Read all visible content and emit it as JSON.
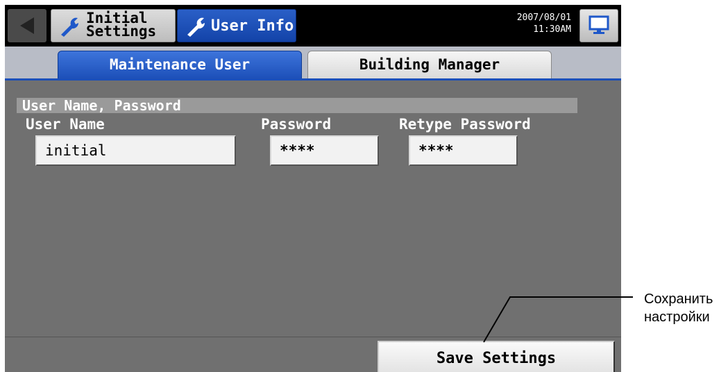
{
  "header": {
    "initial_settings_label": "Initial\nSettings",
    "user_info_label": "User Info",
    "date": "2007/08/01",
    "time": "11:30AM"
  },
  "tabs": [
    {
      "label": "Maintenance User",
      "active": true
    },
    {
      "label": "Building Manager",
      "active": false
    }
  ],
  "section": {
    "title": "User Name, Password",
    "fields": [
      {
        "label": "User Name",
        "value": "initial"
      },
      {
        "label": "Password",
        "value": "****"
      },
      {
        "label": "Retype Password",
        "value": "****"
      }
    ]
  },
  "footer": {
    "save_label": "Save Settings"
  },
  "annotation": {
    "line1": "Сохранить",
    "line2": "настройки"
  },
  "colors": {
    "accent": "#1c4fb8",
    "panel": "#707070"
  }
}
